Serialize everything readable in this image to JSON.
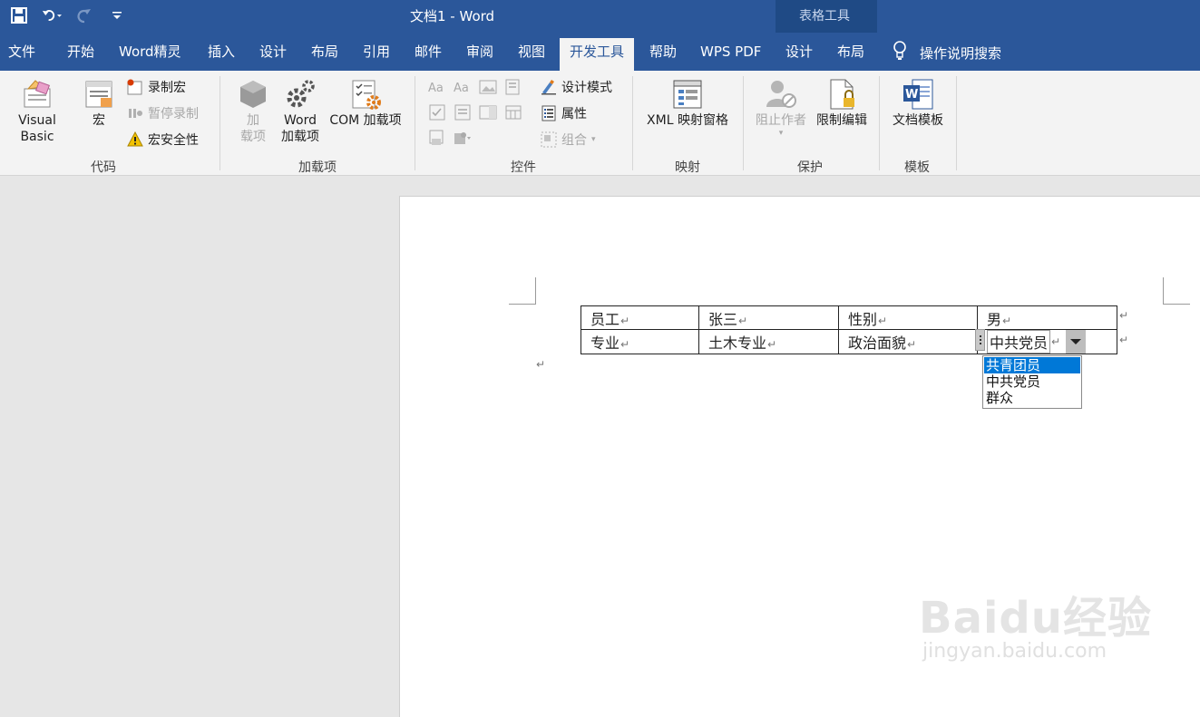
{
  "app": {
    "title": "文档1  -  Word",
    "contextual_group": "表格工具"
  },
  "tabs": [
    {
      "label": "文件"
    },
    {
      "label": "开始"
    },
    {
      "label": "Word精灵"
    },
    {
      "label": "插入"
    },
    {
      "label": "设计"
    },
    {
      "label": "布局"
    },
    {
      "label": "引用"
    },
    {
      "label": "邮件"
    },
    {
      "label": "审阅"
    },
    {
      "label": "视图"
    },
    {
      "label": "开发工具"
    },
    {
      "label": "帮助"
    },
    {
      "label": "WPS PDF"
    },
    {
      "label": "设计"
    },
    {
      "label": "布局"
    }
  ],
  "search": {
    "label": "操作说明搜索"
  },
  "ribbon": {
    "code": {
      "label": "代码",
      "visual_basic": "Visual Basic",
      "macros": "宏",
      "record_macro": "录制宏",
      "pause_recording": "暂停录制",
      "macro_security": "宏安全性"
    },
    "addins": {
      "label": "加载项",
      "addins_line1": "加",
      "addins_line2": "载项",
      "word_addins_line1": "Word",
      "word_addins_line2": "加载项",
      "com_addins": "COM 加载项"
    },
    "controls": {
      "label": "控件",
      "design_mode": "设计模式",
      "properties": "属性",
      "group": "组合"
    },
    "mapping": {
      "label": "映射",
      "xml_pane": "XML 映射窗格"
    },
    "protect": {
      "label": "保护",
      "block_authors": "阻止作者",
      "restrict_editing": "限制编辑"
    },
    "templates": {
      "label": "模板",
      "document_template": "文档模板"
    }
  },
  "document": {
    "table": [
      [
        "员工",
        "张三",
        "性别",
        "男"
      ],
      [
        "专业",
        "土木专业",
        "政治面貌",
        "中共党员"
      ]
    ],
    "dropdown_options": [
      "共青团员",
      "中共党员",
      "群众"
    ],
    "dropdown_selected_index": 0
  },
  "watermark": {
    "main": "Baidu经验",
    "sub": "jingyan.baidu.com"
  },
  "colors": {
    "ribbon_blue": "#2b579a",
    "selection_blue": "#0078d7"
  }
}
